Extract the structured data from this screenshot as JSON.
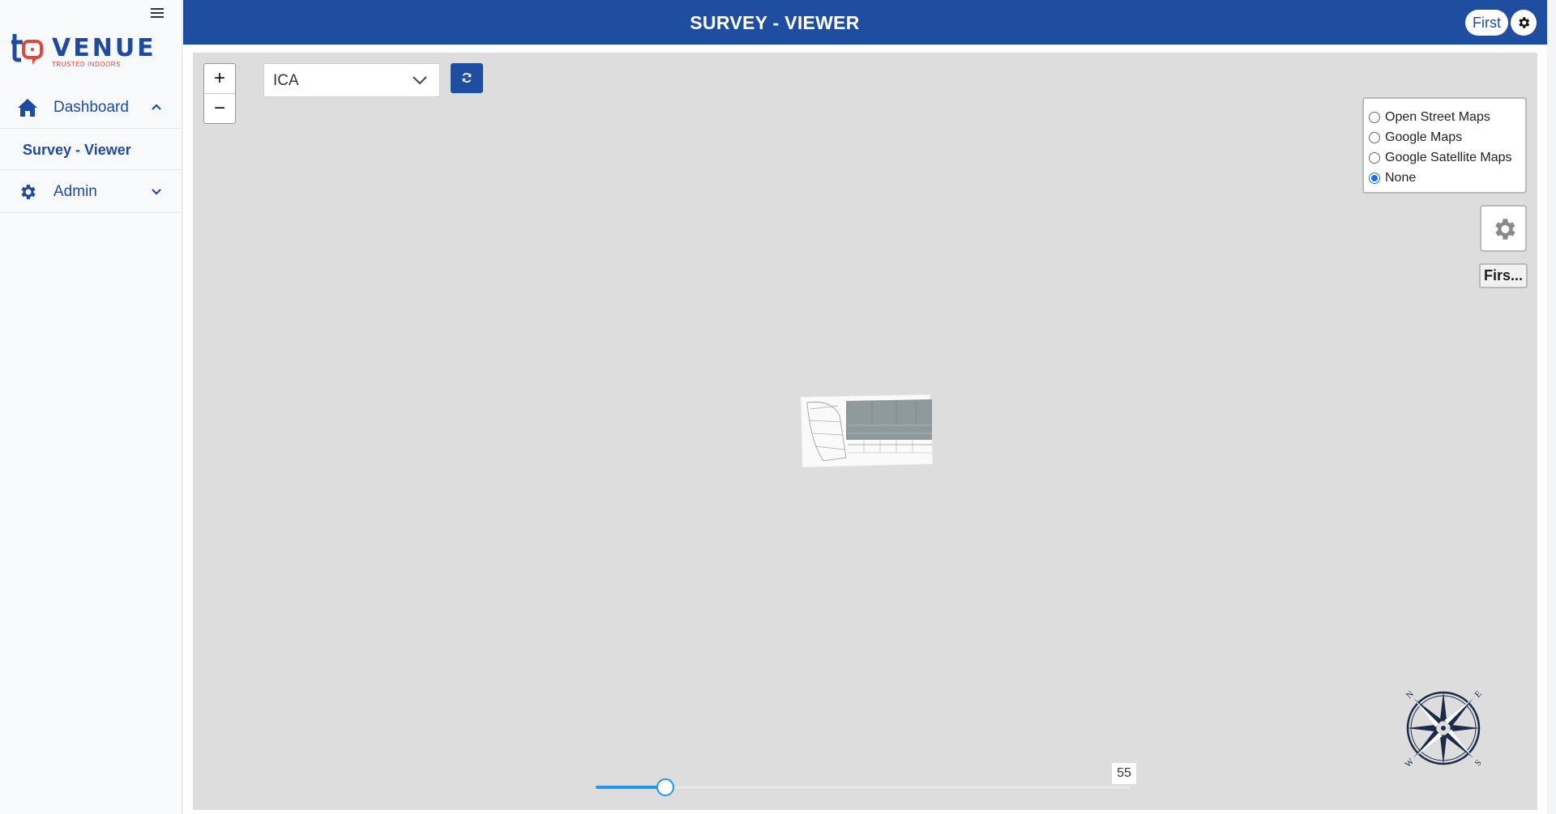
{
  "sidebar": {
    "logo_word": "VENUE",
    "logo_tagline": "TRUSTED INDOORS",
    "items": [
      {
        "label": "Dashboard",
        "icon": "home-icon",
        "expanded": true
      },
      {
        "label": "Survey - Viewer",
        "icon": "",
        "active": true
      },
      {
        "label": "Admin",
        "icon": "gear-icon",
        "expanded": false
      }
    ]
  },
  "header": {
    "title": "SURVEY - VIEWER",
    "floor_label": "First",
    "settings_icon": "gear-icon",
    "color": "#1f4ea1"
  },
  "map": {
    "venue_select": {
      "value": "ICA"
    },
    "zoom_in": "+",
    "zoom_out": "−",
    "refresh_icon": "refresh-icon",
    "layers": [
      {
        "label": "Open Street Maps",
        "checked": false
      },
      {
        "label": "Google Maps",
        "checked": false
      },
      {
        "label": "Google Satellite Maps",
        "checked": false
      },
      {
        "label": "None",
        "checked": true
      }
    ],
    "floor_button": "Firs...",
    "slider": {
      "value": "55",
      "fraction": 0.13
    },
    "compass": {
      "n": "N",
      "e": "E",
      "s": "S",
      "w": "W"
    }
  }
}
